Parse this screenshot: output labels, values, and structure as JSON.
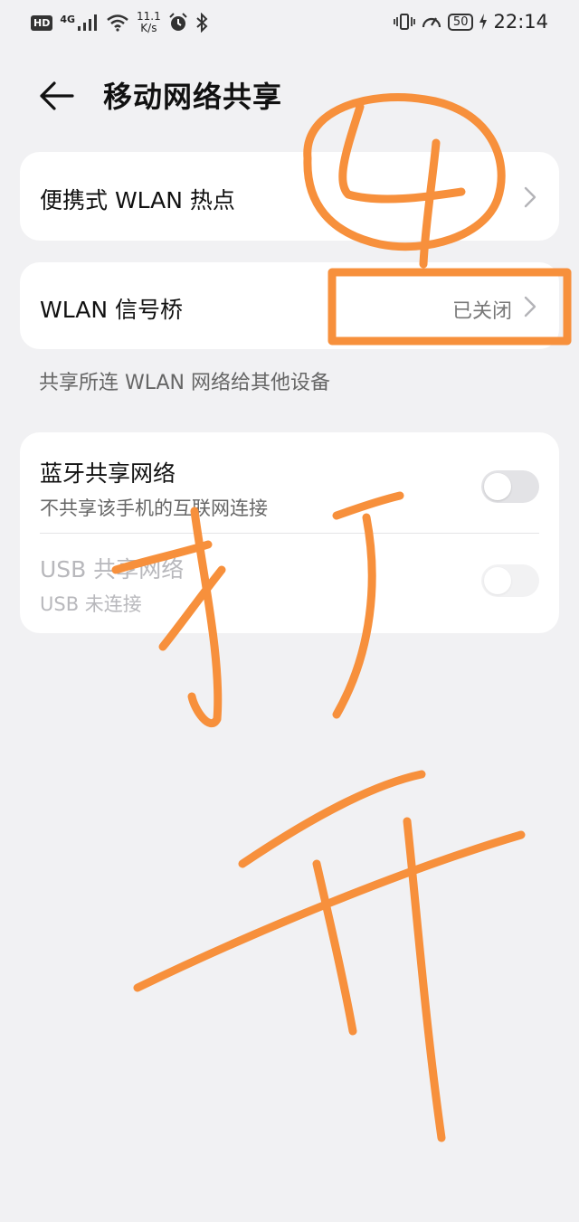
{
  "status_bar": {
    "hd": "HD",
    "network": "4G",
    "speed_value": "11.1",
    "speed_unit": "K/s",
    "battery": "50",
    "time": "22:14"
  },
  "header": {
    "title": "移动网络共享"
  },
  "hotspot": {
    "label": "便携式 WLAN 热点"
  },
  "bridge": {
    "label": "WLAN 信号桥",
    "status": "已关闭",
    "footnote": "共享所连 WLAN 网络给其他设备"
  },
  "bluetooth": {
    "label": "蓝牙共享网络",
    "sublabel": "不共享该手机的互联网连接"
  },
  "usb": {
    "label": "USB 共享网络",
    "sublabel": "USB 未连接"
  },
  "annotation": {
    "color": "#f7903c"
  }
}
